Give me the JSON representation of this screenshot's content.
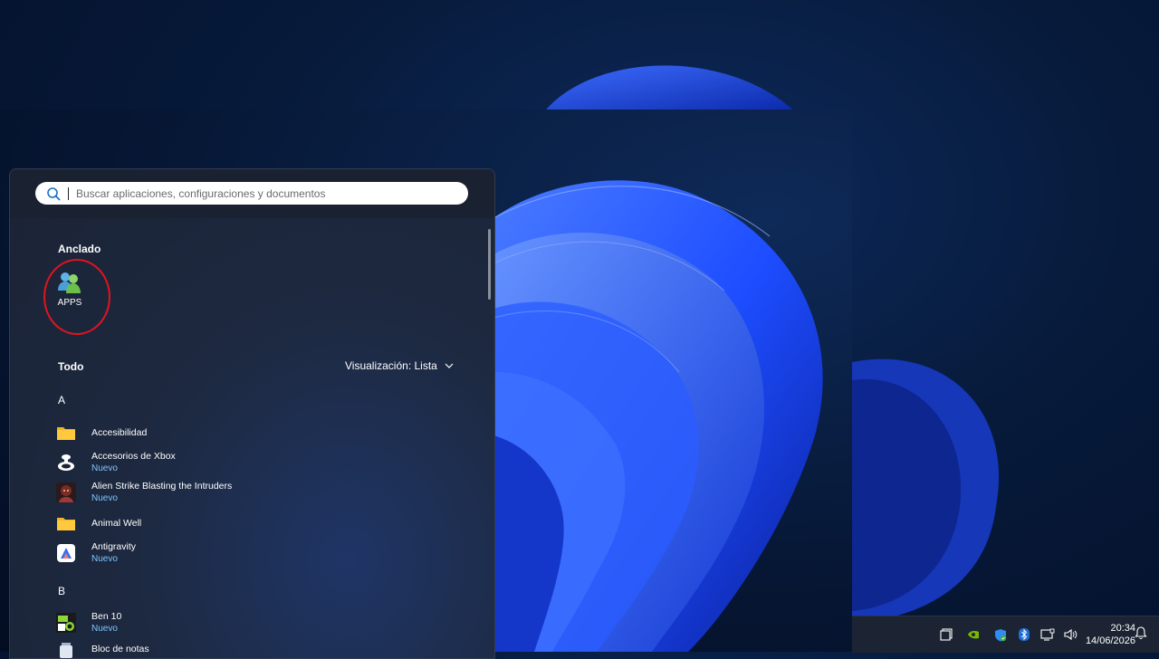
{
  "search": {
    "placeholder": "Buscar aplicaciones, configuraciones y documentos"
  },
  "pinned": {
    "title": "Anclado",
    "apps": [
      {
        "label": "APPS",
        "icon": "users-icon"
      }
    ]
  },
  "all": {
    "title": "Todo",
    "view_label": "Visualización: Lista",
    "groups": [
      {
        "letter": "A"
      },
      {
        "letter": "B"
      }
    ],
    "apps": [
      {
        "name": "Accesibilidad",
        "badge": "",
        "icon": "folder-icon"
      },
      {
        "name": "Accesorios de Xbox",
        "badge": "Nuevo",
        "icon": "xbox-controller-icon"
      },
      {
        "name": "Alien Strike Blasting the Intruders",
        "badge": "Nuevo",
        "icon": "game-character-icon"
      },
      {
        "name": "Animal Well",
        "badge": "",
        "icon": "folder-icon"
      },
      {
        "name": "Antigravity",
        "badge": "Nuevo",
        "icon": "antigravity-icon"
      },
      {
        "name": "Ben 10",
        "badge": "Nuevo",
        "icon": "ben10-icon"
      },
      {
        "name": "Bloc de notas",
        "badge": "",
        "icon": "notepad-icon"
      }
    ]
  },
  "taskbar": {
    "time": "20:34",
    "date": "14/06/2026"
  },
  "colors": {
    "accent_new": "#7dc5ff",
    "highlight": "#e0141e"
  }
}
